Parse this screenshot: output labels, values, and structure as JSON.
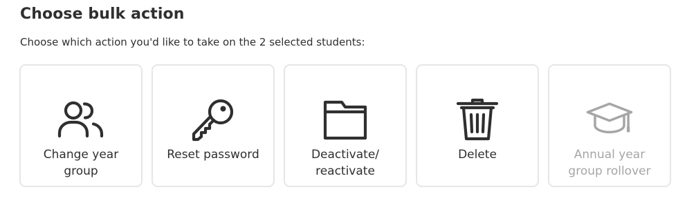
{
  "title": "Choose bulk action",
  "subtitle": "Choose which action you'd like to take on the 2 selected students:",
  "colors": {
    "icon": "#2f2f2f",
    "icon_disabled": "#a6a6a6",
    "card_border": "#e6e6e6"
  },
  "actions": [
    {
      "label_line1": "Change year",
      "label_line2": "group",
      "icon": "users-icon",
      "enabled": true
    },
    {
      "label_line1": "Reset password",
      "label_line2": "",
      "icon": "key-icon",
      "enabled": true
    },
    {
      "label_line1": "Deactivate/",
      "label_line2": "reactivate",
      "icon": "folder-icon",
      "enabled": true
    },
    {
      "label_line1": "Delete",
      "label_line2": "",
      "icon": "trash-icon",
      "enabled": true
    },
    {
      "label_line1": "Annual year",
      "label_line2": "group rollover",
      "icon": "graduation-cap-icon",
      "enabled": false
    }
  ]
}
